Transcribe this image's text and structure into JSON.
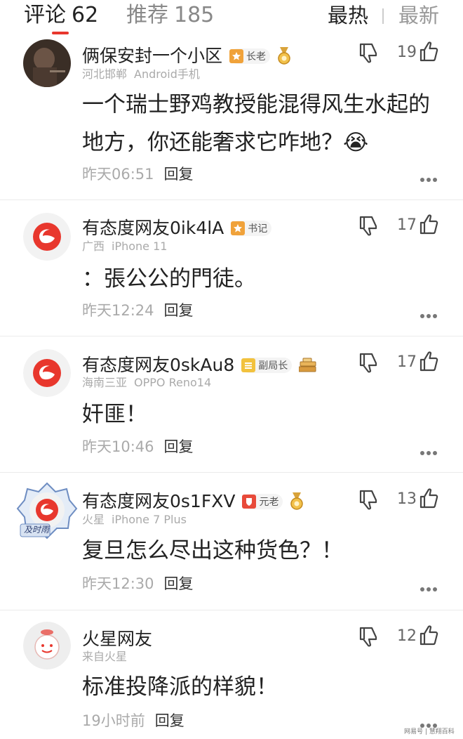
{
  "header": {
    "tabs": [
      {
        "label": "评论",
        "count": "62"
      },
      {
        "label": "推荐",
        "count": "185"
      }
    ],
    "sort": {
      "hot": "最热",
      "new": "最新"
    }
  },
  "comments": [
    {
      "username": "俩保安封一个小区",
      "badge": "长老",
      "location": "河北邯郸",
      "device": "Android手机",
      "content": "一个瑞士野鸡教授能混得风生水起的地方，你还能奢求它咋地？😭",
      "time": "昨天06:51",
      "reply": "回复",
      "likes": "19"
    },
    {
      "username": "有态度网友0ik4lA",
      "badge": "书记",
      "location": "广西",
      "device": "iPhone 11",
      "content": "：張公公的門徒。",
      "time": "昨天12:24",
      "reply": "回复",
      "likes": "17"
    },
    {
      "username": "有态度网友0skAu8",
      "badge": "副局长",
      "location": "海南三亚",
      "device": "OPPO Reno14",
      "content": "奸匪！",
      "time": "昨天10:46",
      "reply": "回复",
      "likes": "17"
    },
    {
      "username": "有态度网友0s1FXV",
      "badge": "元老",
      "avatar_text": "及时雨",
      "location": "火星",
      "device": "iPhone 7 Plus",
      "content": "复旦怎么尽出这种货色？！",
      "time": "昨天12:30",
      "reply": "回复",
      "likes": "13"
    },
    {
      "username": "火星网友",
      "location": "来自火星",
      "content": "标准投降派的样貌！",
      "time": "19小时前",
      "reply": "回复",
      "likes": "12"
    }
  ],
  "watermark": "网易号 | 慧翔百科",
  "colors": {
    "accent": "#e8372d",
    "muted": "#aaaaaa",
    "badge_orange": "#f0a23a",
    "badge_red": "#e84a3a"
  }
}
